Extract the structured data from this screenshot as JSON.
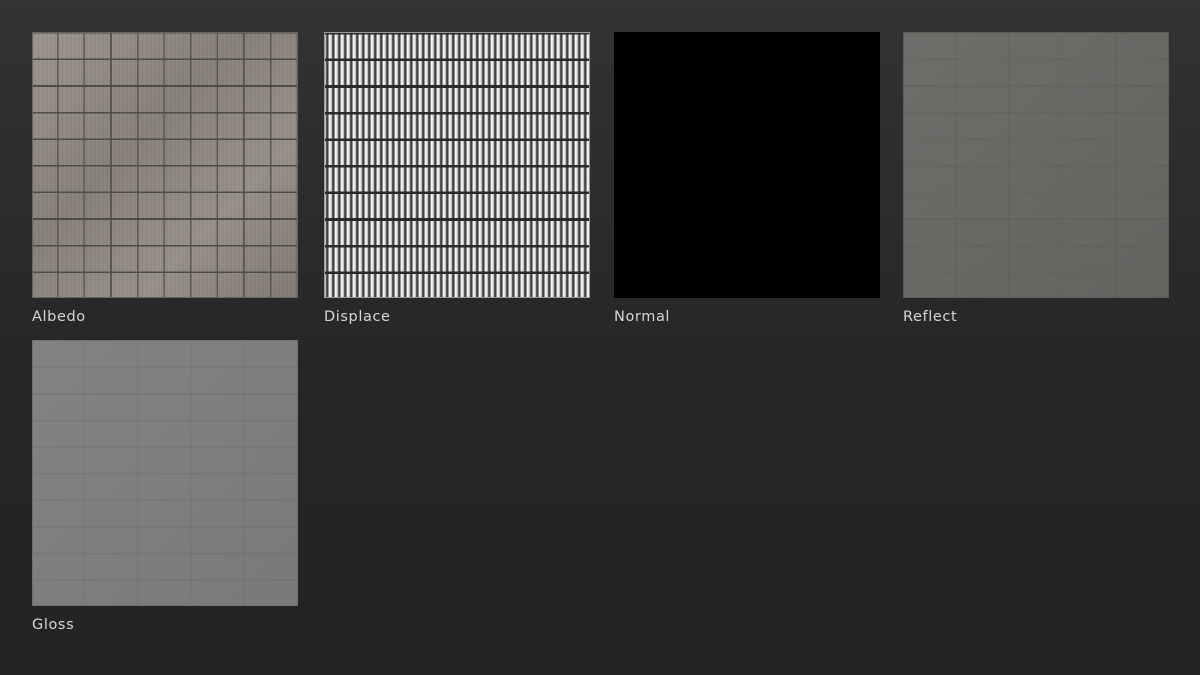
{
  "maps": [
    {
      "label": "Albedo",
      "swatch": "#8f8881"
    },
    {
      "label": "Displace",
      "swatch": "#d0d0d0"
    },
    {
      "label": "Normal",
      "swatch": "#000000"
    },
    {
      "label": "Reflect",
      "swatch": "#686764"
    },
    {
      "label": "Gloss",
      "swatch": "#7e7e7e"
    }
  ],
  "colors": {
    "background": "#2a2a2a",
    "label_text": "#d6d6d6"
  }
}
